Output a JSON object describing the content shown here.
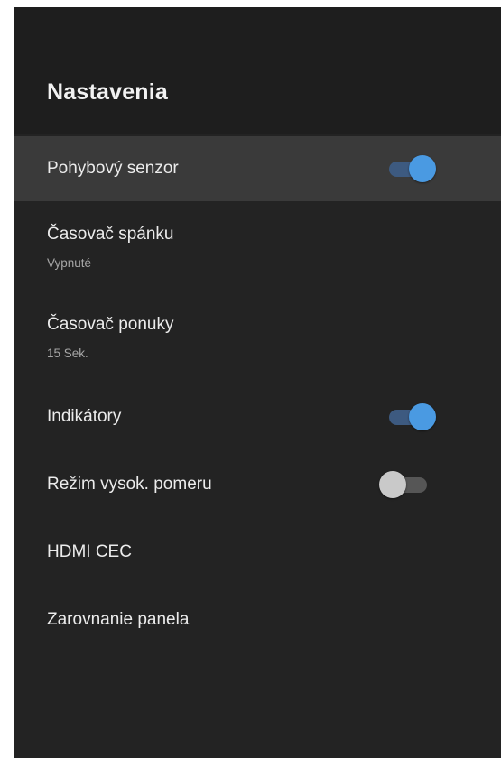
{
  "header": {
    "title": "Nastavenia"
  },
  "items": [
    {
      "label": "Pohybový senzor",
      "toggle": true,
      "selected": true
    },
    {
      "label": "Časovač spánku",
      "sub": "Vypnuté"
    },
    {
      "label": "Časovač ponuky",
      "sub": "15 Sek."
    },
    {
      "label": "Indikátory",
      "toggle": true
    },
    {
      "label": "Režim vysok. pomeru",
      "toggle": false
    },
    {
      "label": "HDMI CEC"
    },
    {
      "label": "Zarovnanie panela"
    }
  ],
  "colors": {
    "panel_bg": "#232323",
    "selected_bg": "#3a3a3a",
    "toggle_on_thumb": "#4a9ae2",
    "toggle_on_track": "#3d5a80",
    "toggle_off_thumb": "#c9c9c9",
    "toggle_off_track": "#565656"
  }
}
